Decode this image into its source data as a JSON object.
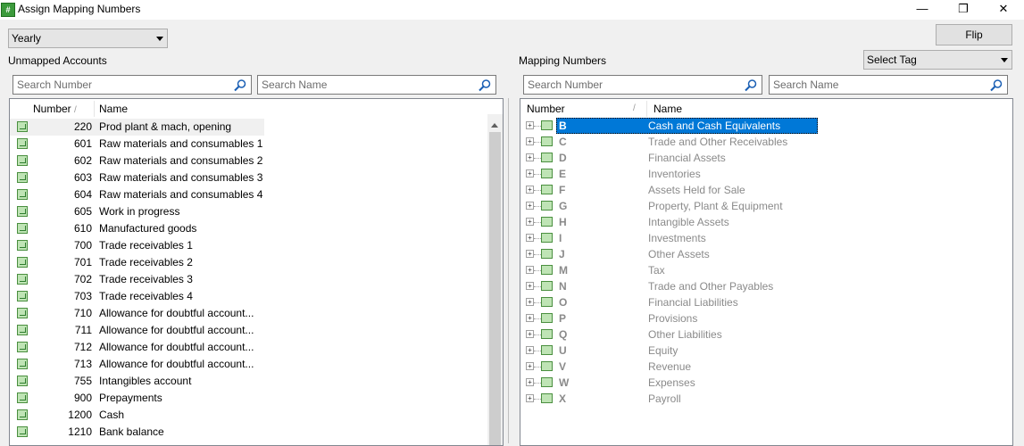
{
  "window": {
    "title": "Assign Mapping Numbers",
    "app_icon": "#",
    "min_glyph": "—",
    "max_glyph": "❐",
    "close_glyph": "✕"
  },
  "period_select": {
    "value": "Yearly"
  },
  "flip_button": {
    "label": "Flip"
  },
  "tag_select": {
    "value": "Select Tag"
  },
  "unmapped": {
    "label": "Unmapped Accounts",
    "search_number_placeholder": "Search Number",
    "search_name_placeholder": "Search Name",
    "columns": {
      "number": "Number",
      "name": "Name",
      "sort_mark": "/"
    },
    "rows": [
      {
        "number": "220",
        "name": "Prod plant & mach, opening"
      },
      {
        "number": "601",
        "name": "Raw materials and consumables 1"
      },
      {
        "number": "602",
        "name": "Raw materials and consumables 2"
      },
      {
        "number": "603",
        "name": "Raw materials and consumables 3"
      },
      {
        "number": "604",
        "name": "Raw materials and consumables 4"
      },
      {
        "number": "605",
        "name": "Work in progress"
      },
      {
        "number": "610",
        "name": "Manufactured goods"
      },
      {
        "number": "700",
        "name": "Trade receivables 1"
      },
      {
        "number": "701",
        "name": "Trade receivables 2"
      },
      {
        "number": "702",
        "name": "Trade receivables 3"
      },
      {
        "number": "703",
        "name": "Trade receivables 4"
      },
      {
        "number": "710",
        "name": "Allowance for doubtful account..."
      },
      {
        "number": "711",
        "name": "Allowance for doubtful account..."
      },
      {
        "number": "712",
        "name": "Allowance for doubtful account..."
      },
      {
        "number": "713",
        "name": "Allowance for doubtful account..."
      },
      {
        "number": "755",
        "name": "Intangibles account"
      },
      {
        "number": "900",
        "name": "Prepayments"
      },
      {
        "number": "1200",
        "name": "Cash"
      },
      {
        "number": "1210",
        "name": "Bank balance"
      }
    ]
  },
  "mapping": {
    "label": "Mapping Numbers",
    "search_number_placeholder": "Search Number",
    "search_name_placeholder": "Search Name",
    "columns": {
      "number": "Number",
      "name": "Name",
      "sort_mark": "/"
    },
    "rows": [
      {
        "code": "B",
        "name": "Cash and Cash Equivalents"
      },
      {
        "code": "C",
        "name": "Trade and Other Receivables"
      },
      {
        "code": "D",
        "name": "Financial Assets"
      },
      {
        "code": "E",
        "name": "Inventories"
      },
      {
        "code": "F",
        "name": "Assets Held for Sale"
      },
      {
        "code": "G",
        "name": "Property, Plant & Equipment"
      },
      {
        "code": "H",
        "name": "Intangible Assets"
      },
      {
        "code": "I",
        "name": "Investments"
      },
      {
        "code": "J",
        "name": "Other Assets"
      },
      {
        "code": "M",
        "name": "Tax"
      },
      {
        "code": "N",
        "name": "Trade and Other Payables"
      },
      {
        "code": "O",
        "name": "Financial Liabilities"
      },
      {
        "code": "P",
        "name": "Provisions"
      },
      {
        "code": "Q",
        "name": "Other Liabilities"
      },
      {
        "code": "U",
        "name": "Equity"
      },
      {
        "code": "V",
        "name": "Revenue"
      },
      {
        "code": "W",
        "name": "Expenses"
      },
      {
        "code": "X",
        "name": "Payroll"
      }
    ]
  },
  "colors": {
    "selection": "#0078d7",
    "icon_green": "#4a8f3f"
  }
}
